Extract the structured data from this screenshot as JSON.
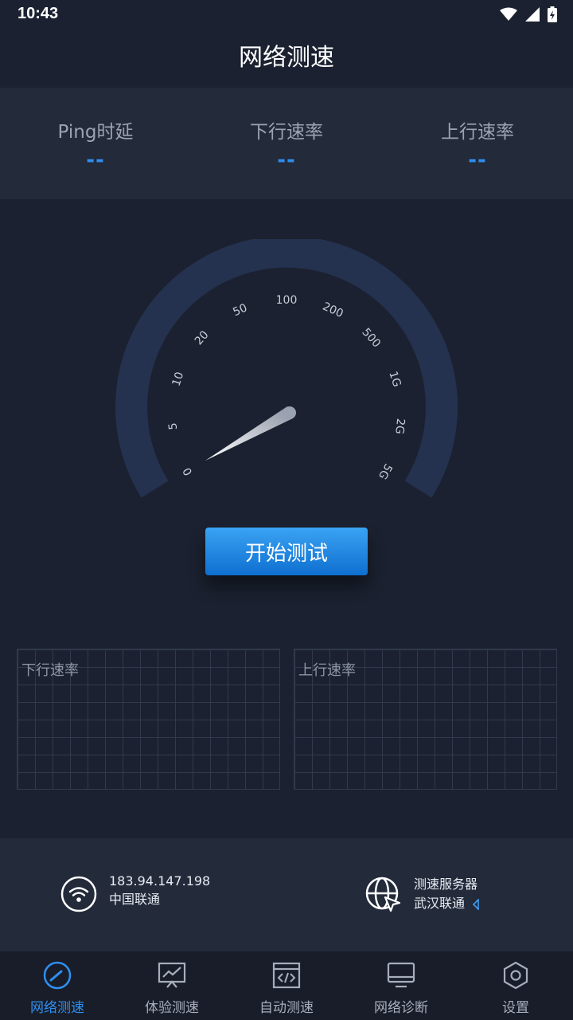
{
  "status_bar": {
    "time": "10:43"
  },
  "header": {
    "title": "网络测速"
  },
  "stats": [
    {
      "label": "Ping时延",
      "value": "--"
    },
    {
      "label": "下行速率",
      "value": "--"
    },
    {
      "label": "上行速率",
      "value": "--"
    }
  ],
  "gauge": {
    "ticks": [
      "0",
      "5",
      "10",
      "20",
      "50",
      "100",
      "200",
      "500",
      "1G",
      "2G",
      "5G"
    ],
    "needle_value": "5"
  },
  "actions": {
    "start_label": "开始测试"
  },
  "charts": {
    "download_label": "下行速率",
    "upload_label": "上行速率"
  },
  "network": {
    "ip": "183.94.147.198",
    "isp": "中国联通",
    "server_title": "测速服务器",
    "server_name": "武汉联通"
  },
  "tabs": [
    {
      "label": "网络测速",
      "icon": "speedometer-icon",
      "active": true
    },
    {
      "label": "体验测速",
      "icon": "chart-monitor-icon",
      "active": false
    },
    {
      "label": "自动测速",
      "icon": "code-window-icon",
      "active": false
    },
    {
      "label": "网络诊断",
      "icon": "monitor-icon",
      "active": false
    },
    {
      "label": "设置",
      "icon": "gear-hex-icon",
      "active": false
    }
  ],
  "colors": {
    "accent": "#2f8ff0",
    "background": "#1b2130",
    "panel": "#232a3a",
    "gauge_arc": "#24324f"
  }
}
